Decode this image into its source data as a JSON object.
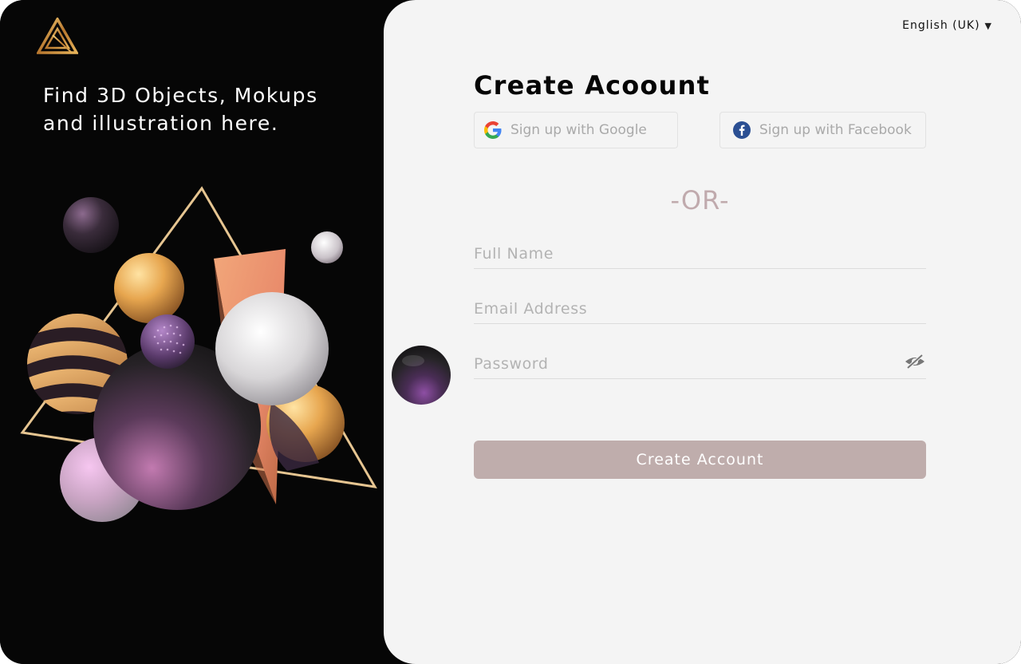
{
  "brand": {
    "tagline": "Find 3D Objects, Mokups and illustration here."
  },
  "header": {
    "language": "English (UK)",
    "language_caret": "▼"
  },
  "form": {
    "title": "Create Acoount",
    "google_label": "Sign up with Google",
    "facebook_label": "Sign up with Facebook",
    "divider": "-OR-",
    "fullname_placeholder": "Full Name",
    "email_placeholder": "Email Address",
    "password_placeholder": "Password",
    "submit_label": "Create Account"
  },
  "colors": {
    "left_panel": "#060606",
    "right_panel": "#f4f4f4",
    "accent_button": "#bfadac",
    "divider_text": "#c0aaad",
    "gold": "#e0b36a"
  },
  "icons": [
    "logo-icon",
    "caret-down-icon",
    "google-icon",
    "facebook-icon",
    "eye-slash-icon"
  ]
}
